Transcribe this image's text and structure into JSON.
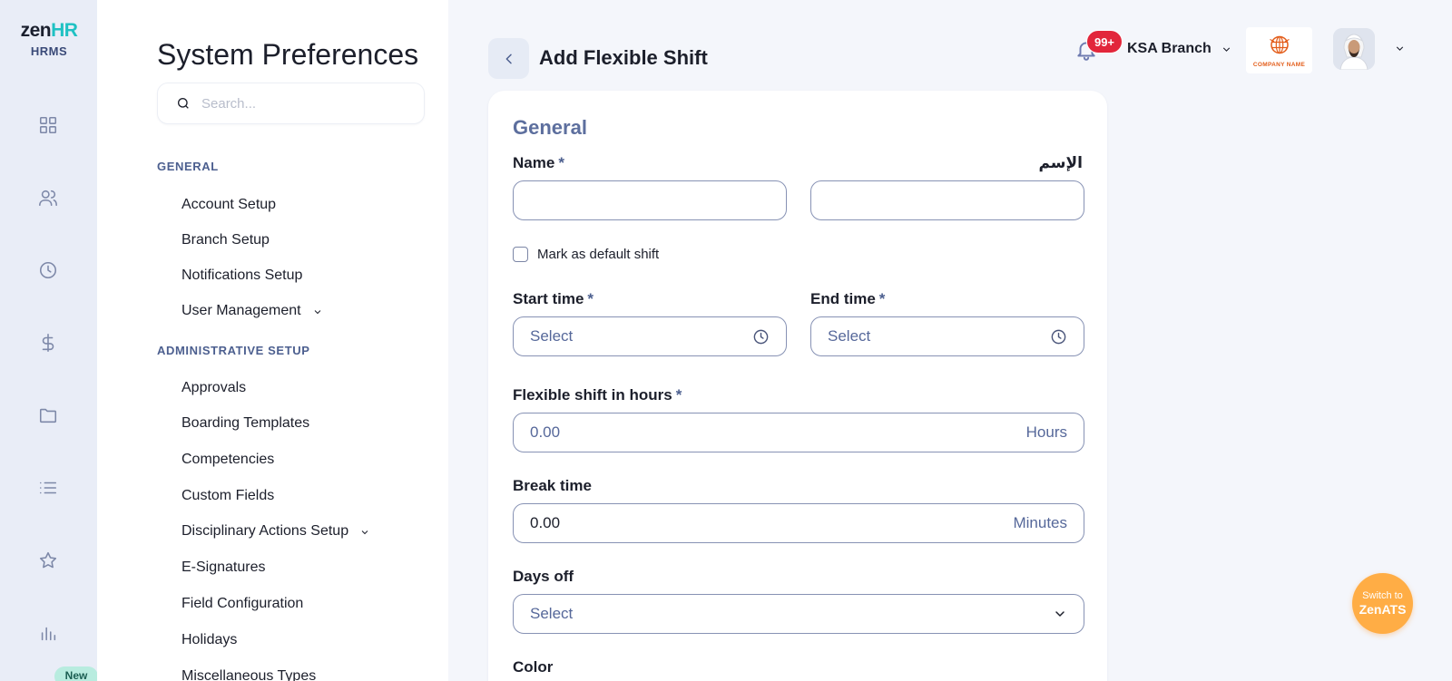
{
  "logo": {
    "brand_main": "zen",
    "brand_accent": "HR",
    "subtitle": "HRMS"
  },
  "rail": {
    "icons": [
      "dashboard-icon",
      "people-icon",
      "clock-icon",
      "dollar-icon",
      "folder-icon",
      "list-icon",
      "star-icon",
      "chart-icon"
    ],
    "new_badge": "New"
  },
  "prefs": {
    "title": "System Preferences",
    "search_placeholder": "Search...",
    "sections": [
      {
        "label": "GENERAL",
        "items": [
          {
            "label": "Account Setup",
            "has_chevron": false
          },
          {
            "label": "Branch Setup",
            "has_chevron": false
          },
          {
            "label": "Notifications Setup",
            "has_chevron": false
          },
          {
            "label": "User Management",
            "has_chevron": true
          }
        ]
      },
      {
        "label": "ADMINISTRATIVE SETUP",
        "items": [
          {
            "label": "Approvals",
            "has_chevron": false
          },
          {
            "label": "Boarding Templates",
            "has_chevron": false
          },
          {
            "label": "Competencies",
            "has_chevron": false
          },
          {
            "label": "Custom Fields",
            "has_chevron": false
          },
          {
            "label": "Disciplinary Actions Setup",
            "has_chevron": true
          },
          {
            "label": "E-Signatures",
            "has_chevron": false
          },
          {
            "label": "Field Configuration",
            "has_chevron": false
          },
          {
            "label": "Holidays",
            "has_chevron": false
          },
          {
            "label": "Miscellaneous Types",
            "has_chevron": false
          }
        ]
      }
    ]
  },
  "header": {
    "page_title": "Add Flexible Shift",
    "notifications_count": "99+",
    "branch": "KSA Branch",
    "company_logo_text": "COMPANY NAME"
  },
  "form": {
    "section_title": "General",
    "name_label": "Name",
    "name_ar_label": "الإسم",
    "name_value": "",
    "name_ar_value": "",
    "required_mark": "*",
    "default_shift_label": "Mark as default shift",
    "start_time_label": "Start time",
    "start_time_placeholder": "Select",
    "end_time_label": "End time",
    "end_time_placeholder": "Select",
    "flex_hours_label": "Flexible shift in hours",
    "flex_hours_placeholder": "0.00",
    "flex_hours_suffix": "Hours",
    "break_label": "Break time",
    "break_value": "0.00",
    "break_suffix": "Minutes",
    "days_off_label": "Days off",
    "days_off_placeholder": "Select",
    "color_label": "Color"
  },
  "switch_ats": {
    "line1": "Switch to",
    "line2": "ZenATS"
  },
  "colors": {
    "accent": "#4c5f8f",
    "badge_red": "#e2263b",
    "switch_orange": "#ffad45",
    "brand_teal": "#1fc1c3"
  }
}
